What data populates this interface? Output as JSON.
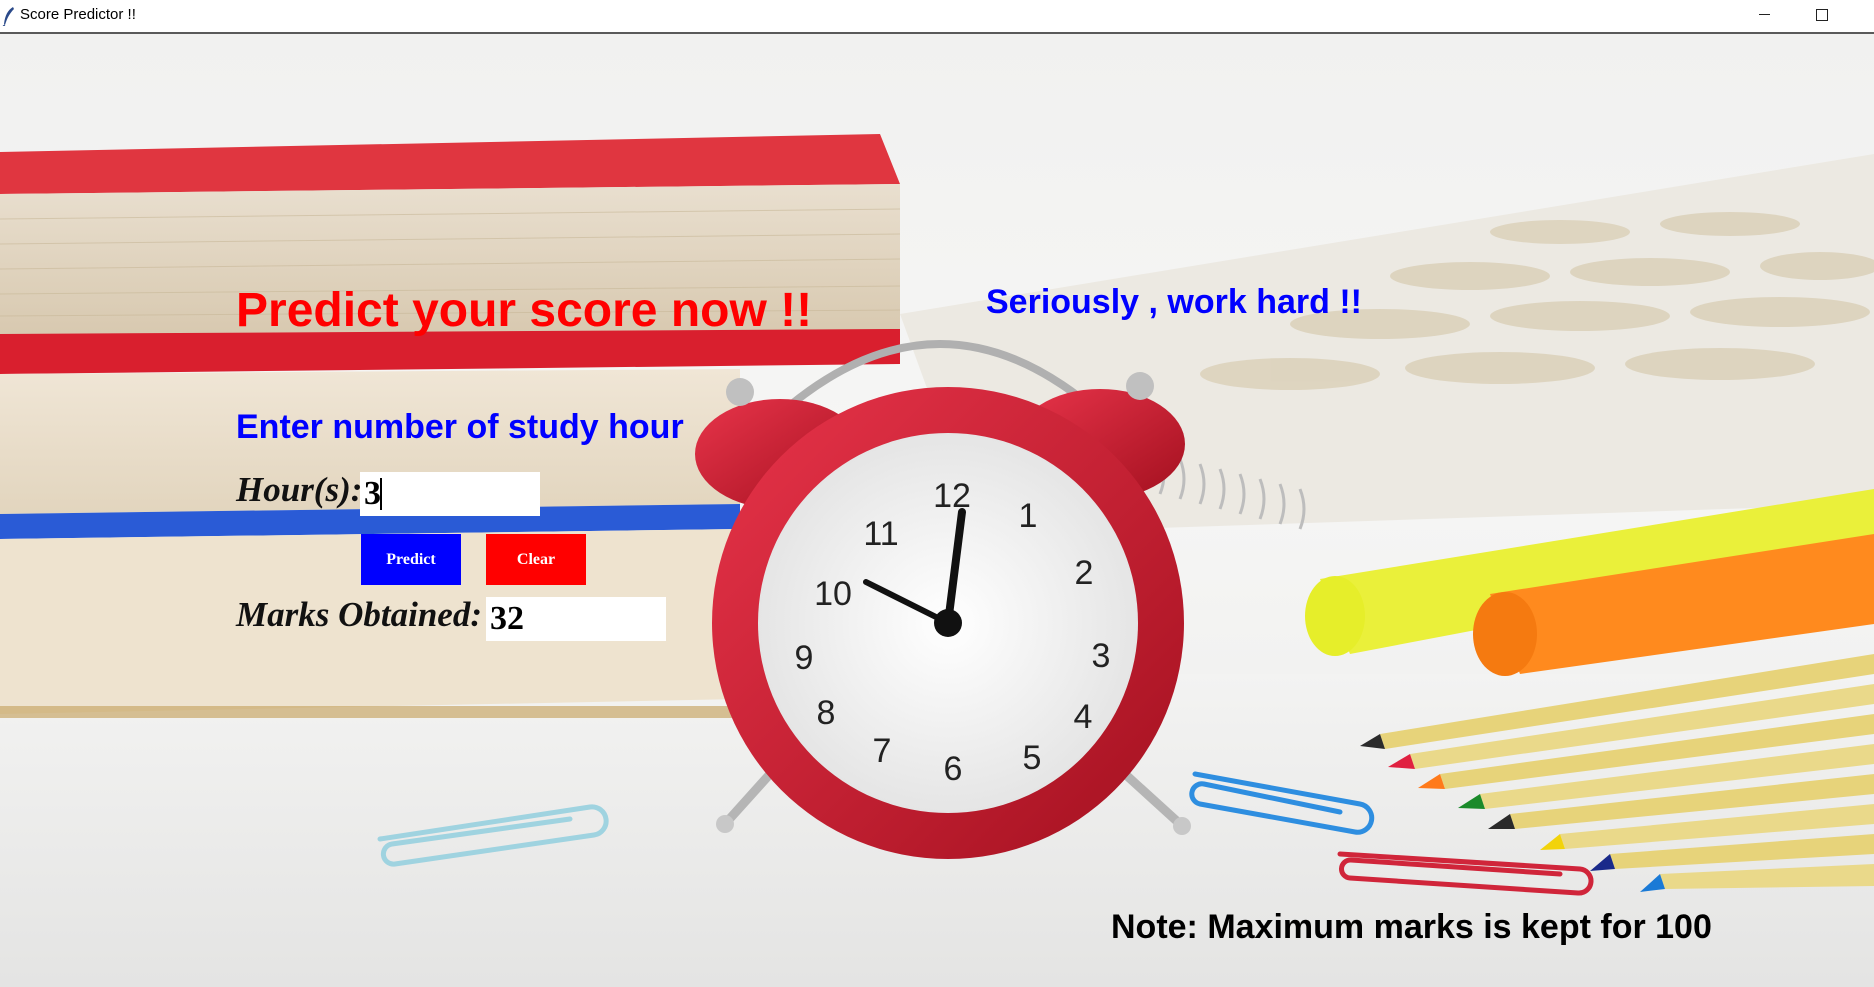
{
  "window": {
    "title": "Score Predictor !!",
    "controls": [
      "minimize",
      "maximize"
    ]
  },
  "main": {
    "heading": "Predict your score now !!",
    "motto": "Seriously , work hard !!",
    "prompt": "Enter number of study hour",
    "hours_label": "Hour(s):",
    "hours_value": "3",
    "predict_label": "Predict",
    "clear_label": "Clear",
    "marks_label": "Marks Obtained:",
    "marks_value": "32",
    "note": "Note: Maximum marks is kept for 100"
  },
  "background": {
    "description_icons": [
      "books-stack",
      "alarm-clock",
      "notebook",
      "highlighters",
      "colored-pencils",
      "paper-clips"
    ],
    "clock_numbers": [
      "12",
      "1",
      "2",
      "3",
      "4",
      "5",
      "6",
      "7",
      "8",
      "9",
      "10",
      "11"
    ]
  },
  "colors": {
    "heading": "#ff0000",
    "accent_blue": "#0000ff",
    "predict_button": "#0000ff",
    "clear_button": "#ff0000"
  }
}
